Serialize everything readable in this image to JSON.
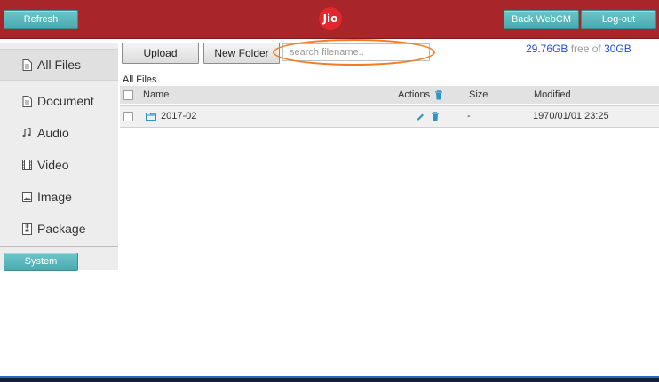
{
  "header": {
    "logo_text": "Jio",
    "refresh_label": "Refresh",
    "back_web_label": "Back WebCM",
    "logout_label": "Log-out"
  },
  "toolbar": {
    "upload_label": "Upload",
    "new_folder_label": "New Folder",
    "search_placeholder": "search filename..",
    "storage": {
      "free": "29.76GB",
      "free_text": " free of ",
      "total": "30GB"
    }
  },
  "sidebar": {
    "items": [
      {
        "label": "All Files",
        "icon": "document-icon",
        "active": true
      },
      {
        "label": "Document",
        "icon": "document-icon"
      },
      {
        "label": "Audio",
        "icon": "music-note-icon"
      },
      {
        "label": "Video",
        "icon": "film-icon"
      },
      {
        "label": "Image",
        "icon": "image-icon"
      },
      {
        "label": "Package",
        "icon": "package-icon"
      }
    ],
    "system_label": "System"
  },
  "main": {
    "breadcrumb": "All Files",
    "columns": {
      "name": "Name",
      "actions": "Actions",
      "size": "Size",
      "modified": "Modified"
    },
    "rows": [
      {
        "name": "2017-02",
        "size": "-",
        "modified": "1970/01/01 23:25",
        "type": "folder"
      }
    ]
  },
  "colors": {
    "header_bg": "#a8262a",
    "accent_teal": "#4aa9ae",
    "storage_blue": "#1f4fd6",
    "highlight_ring": "#f07c23"
  }
}
